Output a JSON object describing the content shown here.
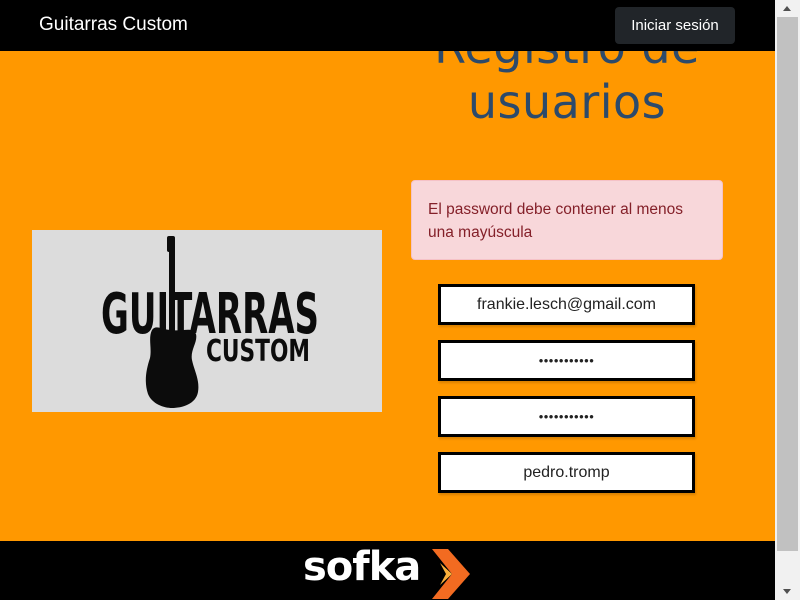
{
  "navbar": {
    "brand": "Guitarras Custom",
    "login_label": "Iniciar sesión"
  },
  "page": {
    "title": "Registro de usuarios"
  },
  "logo": {
    "line1": "GUITARRAS",
    "line2": "CUSTOM",
    "icon": "guitar-icon"
  },
  "alert": {
    "message": "El password debe contener al menos una mayúscula"
  },
  "form": {
    "email_value": "frankie.lesch@gmail.com",
    "password_value": "•••••••••••",
    "password_confirm_value": "•••••••••••",
    "username_value": "pedro.tromp"
  },
  "footer": {
    "brand": "sofka",
    "icon": "sofka-arrow-icon"
  },
  "colors": {
    "background": "#ff9800",
    "title": "#2c4a6b",
    "alert_bg": "#f8d7da",
    "alert_text": "#842029"
  }
}
